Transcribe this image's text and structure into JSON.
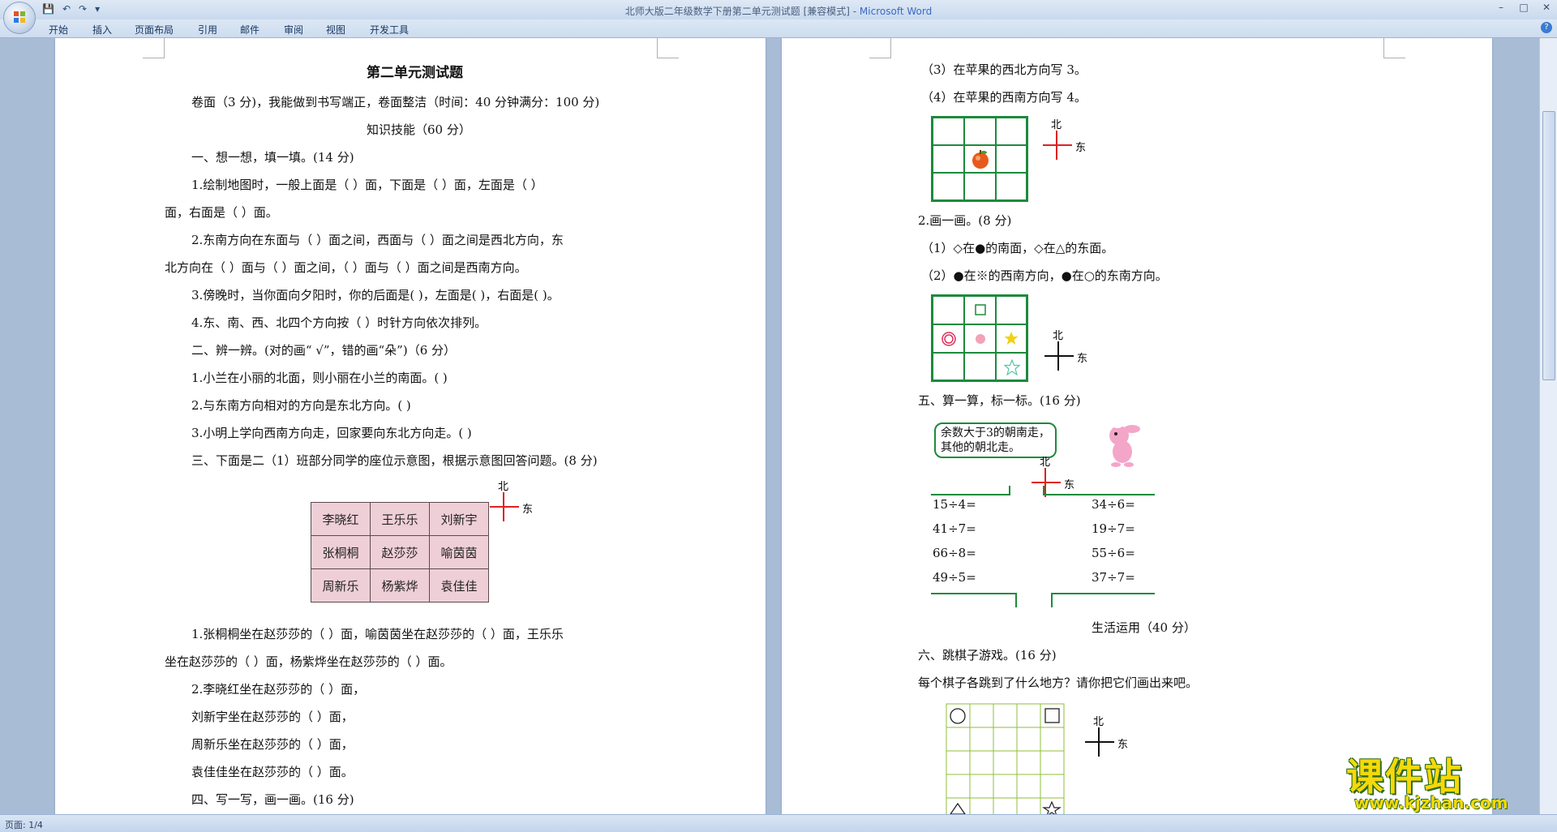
{
  "window": {
    "title": "北师大版二年级数学下册第二单元测试题 [兼容模式] - ",
    "app_name": "Microsoft Word",
    "controls": [
      "–",
      "□",
      "✕"
    ]
  },
  "ribbon": {
    "tabs": [
      "开始",
      "插入",
      "页面布局",
      "引用",
      "邮件",
      "审阅",
      "视图",
      "开发工具"
    ],
    "help": "?"
  },
  "page1": {
    "title": "第二单元测试题",
    "lines": [
      "卷面（3 分)，我能做到书写端正，卷面整洁（时间：40 分钟满分：100 分)",
      "知识技能（60 分）",
      "一、想一想，填一填。(14 分)",
      "1.绘制地图时，一般上面是（     ）面，下面是（     ）面，左面是（     ）",
      "面，右面是（     ）面。",
      "2.东南方向在东面与（     ）面之间，西面与（     ）面之间是西北方向，东",
      "北方向在（     ）面与（     ）面之间，（     ）面与（     ）面之间是西南方向。",
      "3.傍晚时，当你面向夕阳时，你的后面是(      )，左面是(      )，右面是(      )。",
      "4.东、南、西、北四个方向按（     ）时针方向依次排列。",
      "二、辨一辨。(对的画“ √”，错的画“朵”)（6 分）",
      "1.小兰在小丽的北面，则小丽在小兰的南面。(     )",
      "2.与东南方向相对的方向是东北方向。(     )",
      "3.小明上学向西南方向走，回家要向东北方向走。(     )",
      "三、下面是二（1）班部分同学的座位示意图，根据示意图回答问题。(8 分)"
    ],
    "seat_table": [
      [
        "李晓红",
        "王乐乐",
        "刘新宇"
      ],
      [
        "张桐桐",
        "赵莎莎",
        "喻茵茵"
      ],
      [
        "周新乐",
        "杨紫烨",
        "袁佳佳"
      ]
    ],
    "compass": {
      "north": "北",
      "east": "东"
    },
    "lines_after": [
      "1.张桐桐坐在赵莎莎的（     ）面，喻茵茵坐在赵莎莎的（     ）面，王乐乐",
      "坐在赵莎莎的（     ）面，杨紫烨坐在赵莎莎的（     ）面。",
      "2.李晓红坐在赵莎莎的（     ）面，",
      "刘新宇坐在赵莎莎的（     ）面，",
      "周新乐坐在赵莎莎的（     ）面，",
      "袁佳佳坐在赵莎莎的（     ）面。",
      "四、写一写，画一画。(16 分)"
    ]
  },
  "page2": {
    "lines_top": [
      "（3）在苹果的西北方向写 3。",
      "（4）在苹果的西南方向写 4。"
    ],
    "compass1": {
      "north": "北",
      "east": "东"
    },
    "draw_section": [
      "2.画一画。(8 分)",
      "（1）◇在●的南面，◇在△的东面。",
      "（2）●在※的西南方向，●在○的东南方向。"
    ],
    "compass2": {
      "north": "北",
      "east": "东"
    },
    "calc_title": "五、算一算，标一标。(16 分)",
    "speech": [
      "余数大于3的朝南走，",
      "其他的朝北走。"
    ],
    "compass3": {
      "north": "北",
      "east": "东"
    },
    "calc_left": [
      "15÷4=",
      "41÷7=",
      "66÷8=",
      "49÷5="
    ],
    "calc_right": [
      "34÷6=",
      "19÷7=",
      "55÷6=",
      "37÷7="
    ],
    "life_title": "生活运用（40 分）",
    "chess_title": "六、跳棋子游戏。(16 分)",
    "chess_q": "每个棋子各跳到了什么地方？请你把它们画出来吧。",
    "compass4": {
      "north": "北",
      "east": "东"
    }
  },
  "status": {
    "page": "页面: 1/4"
  },
  "watermark": {
    "big": "课件站",
    "small": "www.kjzhan.com"
  },
  "colors": {
    "grid_green": "#1d8a3d",
    "compass_red": "#e02020",
    "seat_pink": "#efcfd7",
    "watermark_yellow": "#f5d90a"
  }
}
